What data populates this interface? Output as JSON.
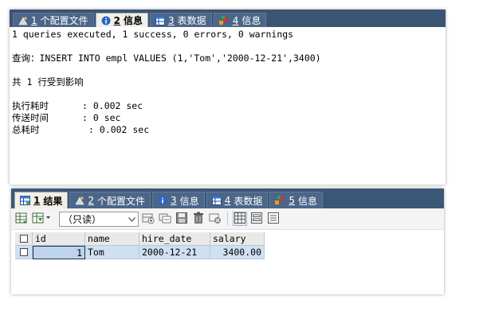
{
  "top_tabs": [
    {
      "num": "1",
      "label": "个配置文件",
      "active": false
    },
    {
      "num": "2",
      "label": "信息",
      "active": true
    },
    {
      "num": "3",
      "label": "表数据",
      "active": false
    },
    {
      "num": "4",
      "label": "信息",
      "active": false
    }
  ],
  "messages": {
    "summary": "1 queries executed, 1 success, 0 errors, 0 warnings",
    "query_label": "查询：",
    "query": "INSERT INTO empl VALUES (1,'Tom','2000-12-21',3400)",
    "affected_prefix": "共",
    "affected_count": "1",
    "affected_suffix": "行受到影响",
    "timings": [
      {
        "label": "执行耗时",
        "value": ": 0.002 sec"
      },
      {
        "label": "传送时间",
        "value": ": 0 sec"
      },
      {
        "label": "总耗时",
        "value": ": 0.002 sec"
      }
    ]
  },
  "bottom_tabs": [
    {
      "num": "1",
      "label": "结果",
      "active": true
    },
    {
      "num": "2",
      "label": "个配置文件",
      "active": false
    },
    {
      "num": "3",
      "label": "信息",
      "active": false
    },
    {
      "num": "4",
      "label": "表数据",
      "active": false
    },
    {
      "num": "5",
      "label": "信息",
      "active": false
    }
  ],
  "toolbar": {
    "mode_select": "（只读）"
  },
  "grid": {
    "columns": [
      "id",
      "name",
      "hire_date",
      "salary"
    ],
    "rows": [
      [
        "1",
        "Tom",
        "2000-12-21",
        "3400.00"
      ]
    ]
  },
  "colors": {
    "tabbar": "#3c5474",
    "active_tab": "#f2f0e6",
    "selected_row": "#cfe0f3"
  }
}
